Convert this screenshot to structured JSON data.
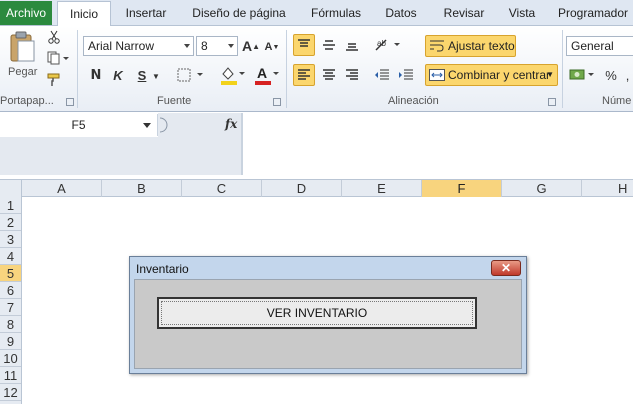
{
  "ribbon": {
    "file_tab": "Archivo",
    "tabs": [
      "Inicio",
      "Insertar",
      "Diseño de página",
      "Fórmulas",
      "Datos",
      "Revisar",
      "Vista",
      "Programador"
    ],
    "active_tab": "Inicio",
    "clipboard": {
      "paste_label": "Pegar",
      "group_label": "Portapap..."
    },
    "font": {
      "name": "Arial Narrow",
      "size": "8",
      "group_label": "Fuente",
      "bold": "N",
      "italic": "K",
      "underline": "S",
      "grow": "A",
      "shrink": "A",
      "font_color_letter": "A",
      "accent_fill": "#f2d21b",
      "accent_font": "#d62222"
    },
    "alignment": {
      "wrap_text": "Ajustar texto",
      "merge_center": "Combinar y centrar",
      "group_label": "Alineación"
    },
    "number": {
      "format": "General",
      "group_label": "Núme",
      "percent": "%"
    }
  },
  "formula_bar": {
    "name_box": "F5",
    "fx_label": "fx",
    "content": ""
  },
  "grid": {
    "columns": [
      "A",
      "B",
      "C",
      "D",
      "E",
      "F",
      "G",
      "H"
    ],
    "rows": [
      "1",
      "2",
      "3",
      "4",
      "5",
      "6",
      "7",
      "8",
      "9",
      "10",
      "11",
      "12"
    ],
    "active_column": "F",
    "active_row": "5"
  },
  "dialog": {
    "title": "Inventario",
    "close_glyph": "✕",
    "button_label": "VER INVENTARIO"
  }
}
